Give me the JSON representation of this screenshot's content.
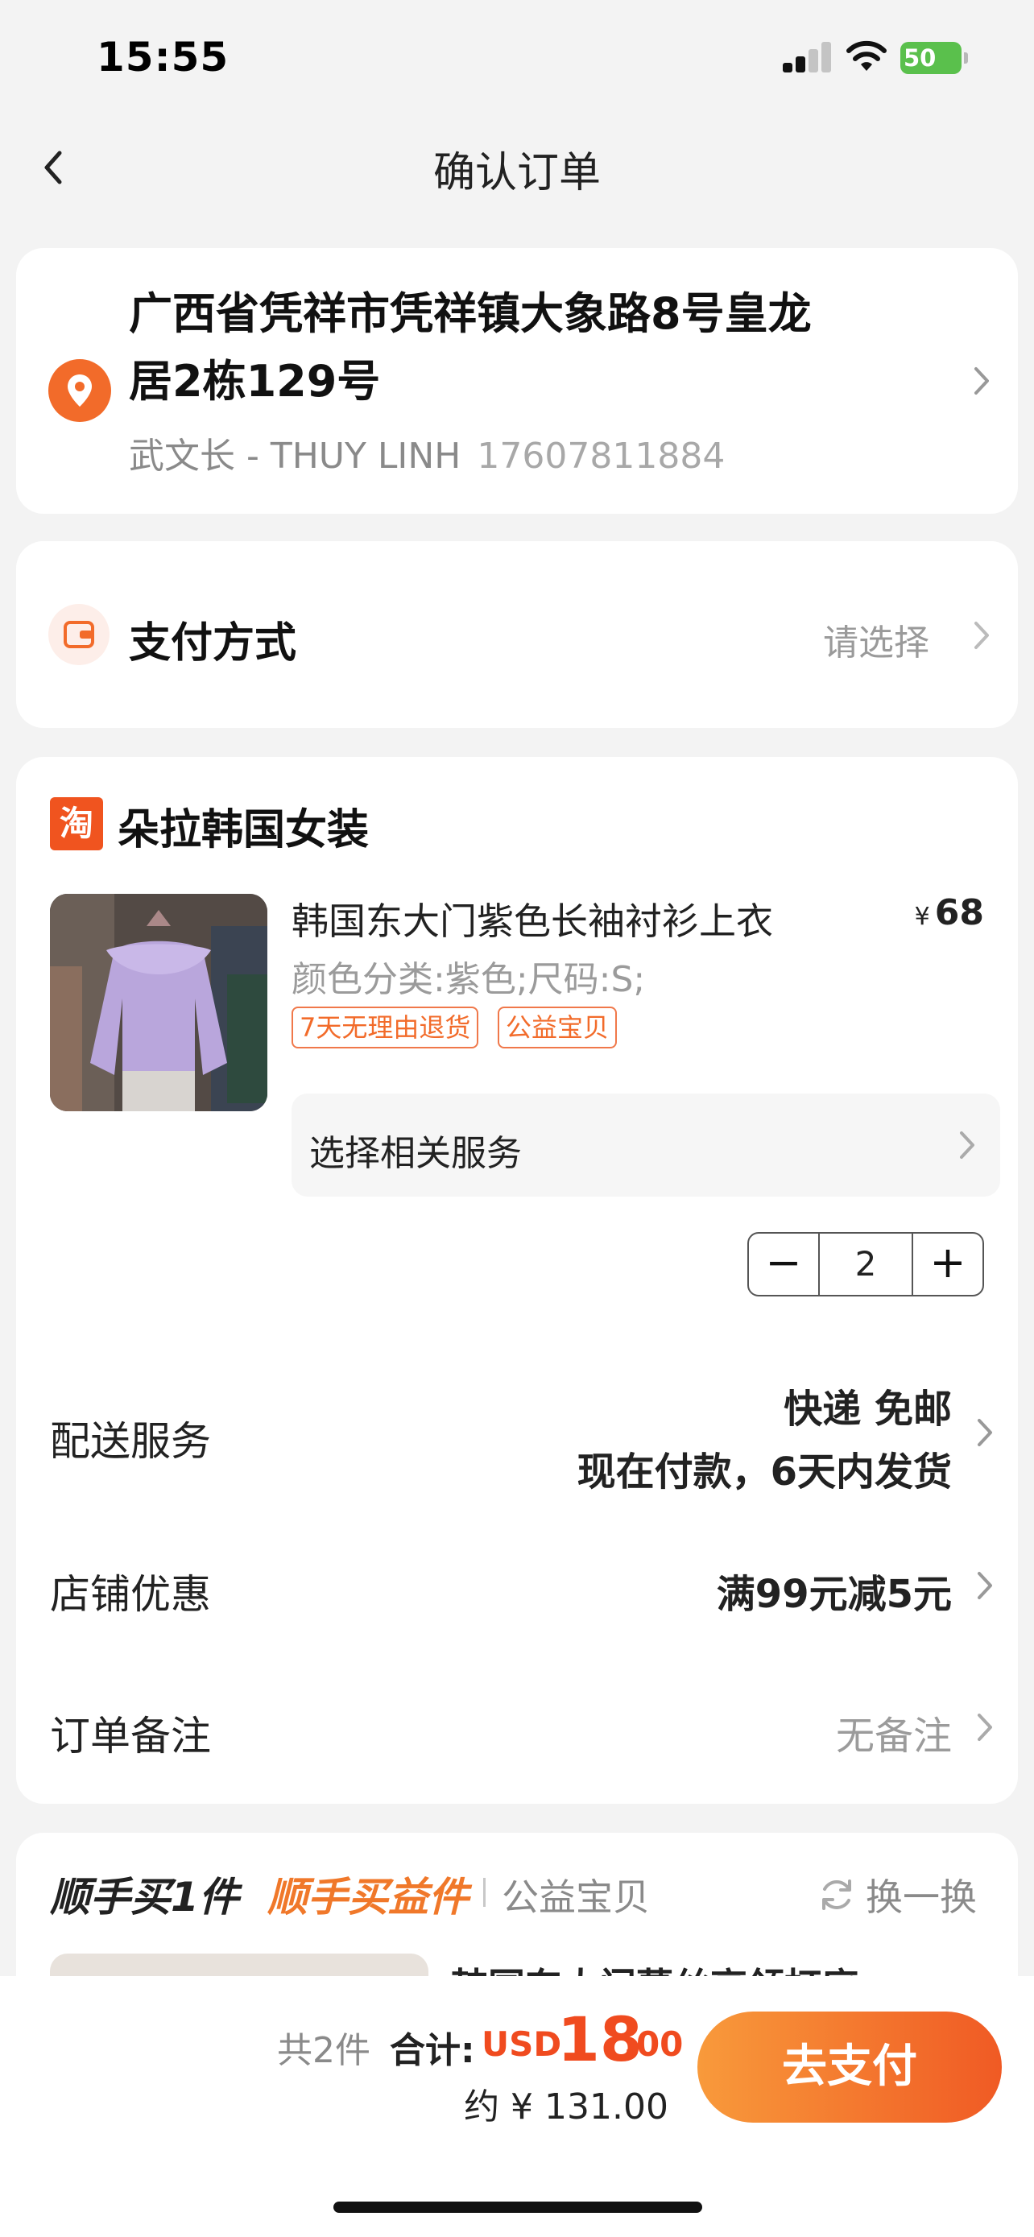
{
  "status_bar": {
    "time": "15:55",
    "battery": "50"
  },
  "nav": {
    "title": "确认订单"
  },
  "address": {
    "line1": "广西省凭祥市凭祥镇大象路8号皇龙",
    "line2": "居2栋129号",
    "recipient": "武文长 - THUY LINH",
    "phone": "17607811884"
  },
  "payment": {
    "label": "支付方式",
    "value": "请选择"
  },
  "shop": {
    "logo_text": "淘",
    "name": "朵拉韩国女装",
    "product": {
      "title": "韩国东大门紫色长袖衬衫上衣",
      "currency": "¥",
      "price": "68",
      "spec": "颜色分类:紫色;尺码:S;",
      "tags": [
        "7天无理由退货",
        "公益宝贝"
      ],
      "service_label": "选择相关服务",
      "quantity": "2",
      "minus": "−",
      "plus": "+"
    },
    "delivery": {
      "label": "配送服务",
      "line1": "快递 免邮",
      "line2": "现在付款，6天内发货"
    },
    "discount": {
      "label": "店铺优惠",
      "value": "满99元减5元"
    },
    "note": {
      "label": "订单备注",
      "value": "无备注"
    }
  },
  "buy_along": {
    "title": "顺手买1件",
    "subtitle": "顺手买益件",
    "category": "公益宝贝",
    "refresh": "换一换",
    "product_title": "韩国东大门蕾丝高领打底"
  },
  "footer": {
    "count": "共2件",
    "total_label": "合计:",
    "currency": "USD",
    "total_int": "18",
    "total_dec": ".00",
    "approx": "约 ¥ 131.00",
    "pay_button": "去支付"
  },
  "colors": {
    "accent": "#f26b2a",
    "price": "#f04b1f",
    "button_start": "#f89a3b",
    "button_end": "#f05a24",
    "battery": "#5ac04c"
  }
}
